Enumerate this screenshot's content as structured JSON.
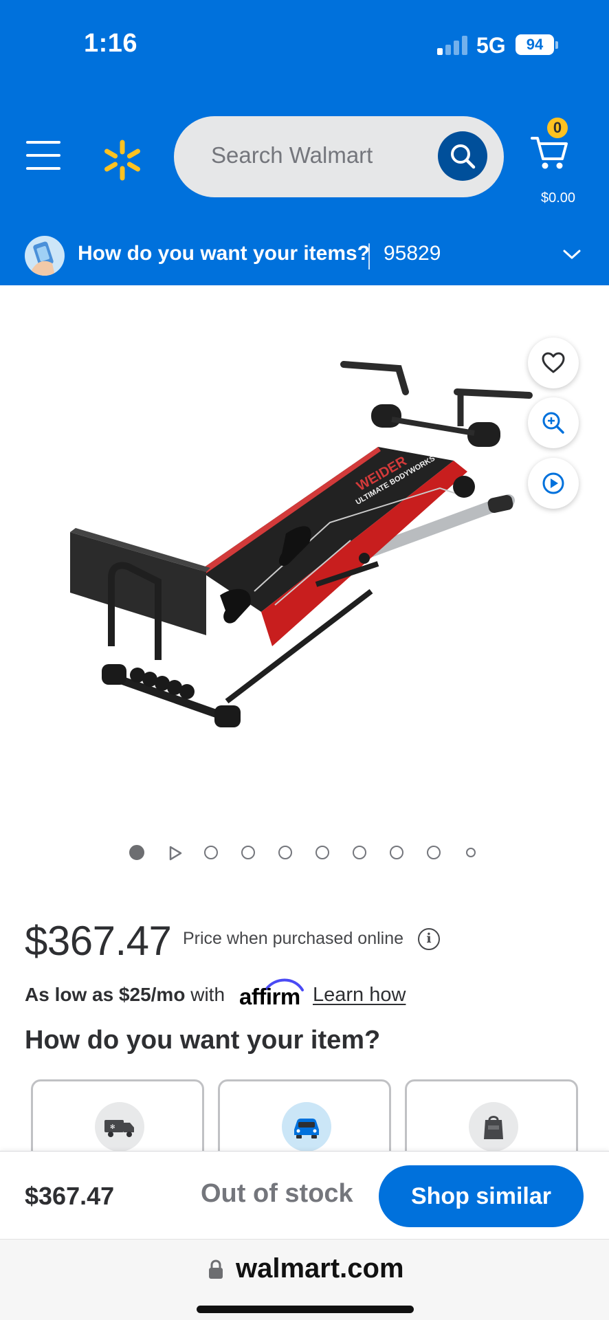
{
  "status_bar": {
    "time": "1:16",
    "network": "5G",
    "battery": "94"
  },
  "header": {
    "search_placeholder": "Search Walmart",
    "cart_count": "0",
    "cart_total": "$0.00",
    "brand_color": "#0071dc",
    "spark_color": "#ffc220"
  },
  "delivery": {
    "prompt": "How do you want your items?",
    "zip": "95829"
  },
  "carousel": {
    "total_slides": 10,
    "active_index": 0,
    "video_index": 1
  },
  "product": {
    "price": "$367.47",
    "price_note": "Price when purchased online",
    "financing": {
      "prefix": "As low as $25/mo",
      "with": "with",
      "provider": "affirm",
      "link": "Learn how"
    }
  },
  "fulfillment": {
    "title": "How do you want your item?",
    "options": [
      "shipping-truck-icon",
      "pickup-car-icon",
      "delivery-bag-icon"
    ]
  },
  "bottom_bar": {
    "price": "$367.47",
    "status": "Out of stock",
    "button": "Shop similar"
  },
  "browser": {
    "url": "walmart.com"
  }
}
